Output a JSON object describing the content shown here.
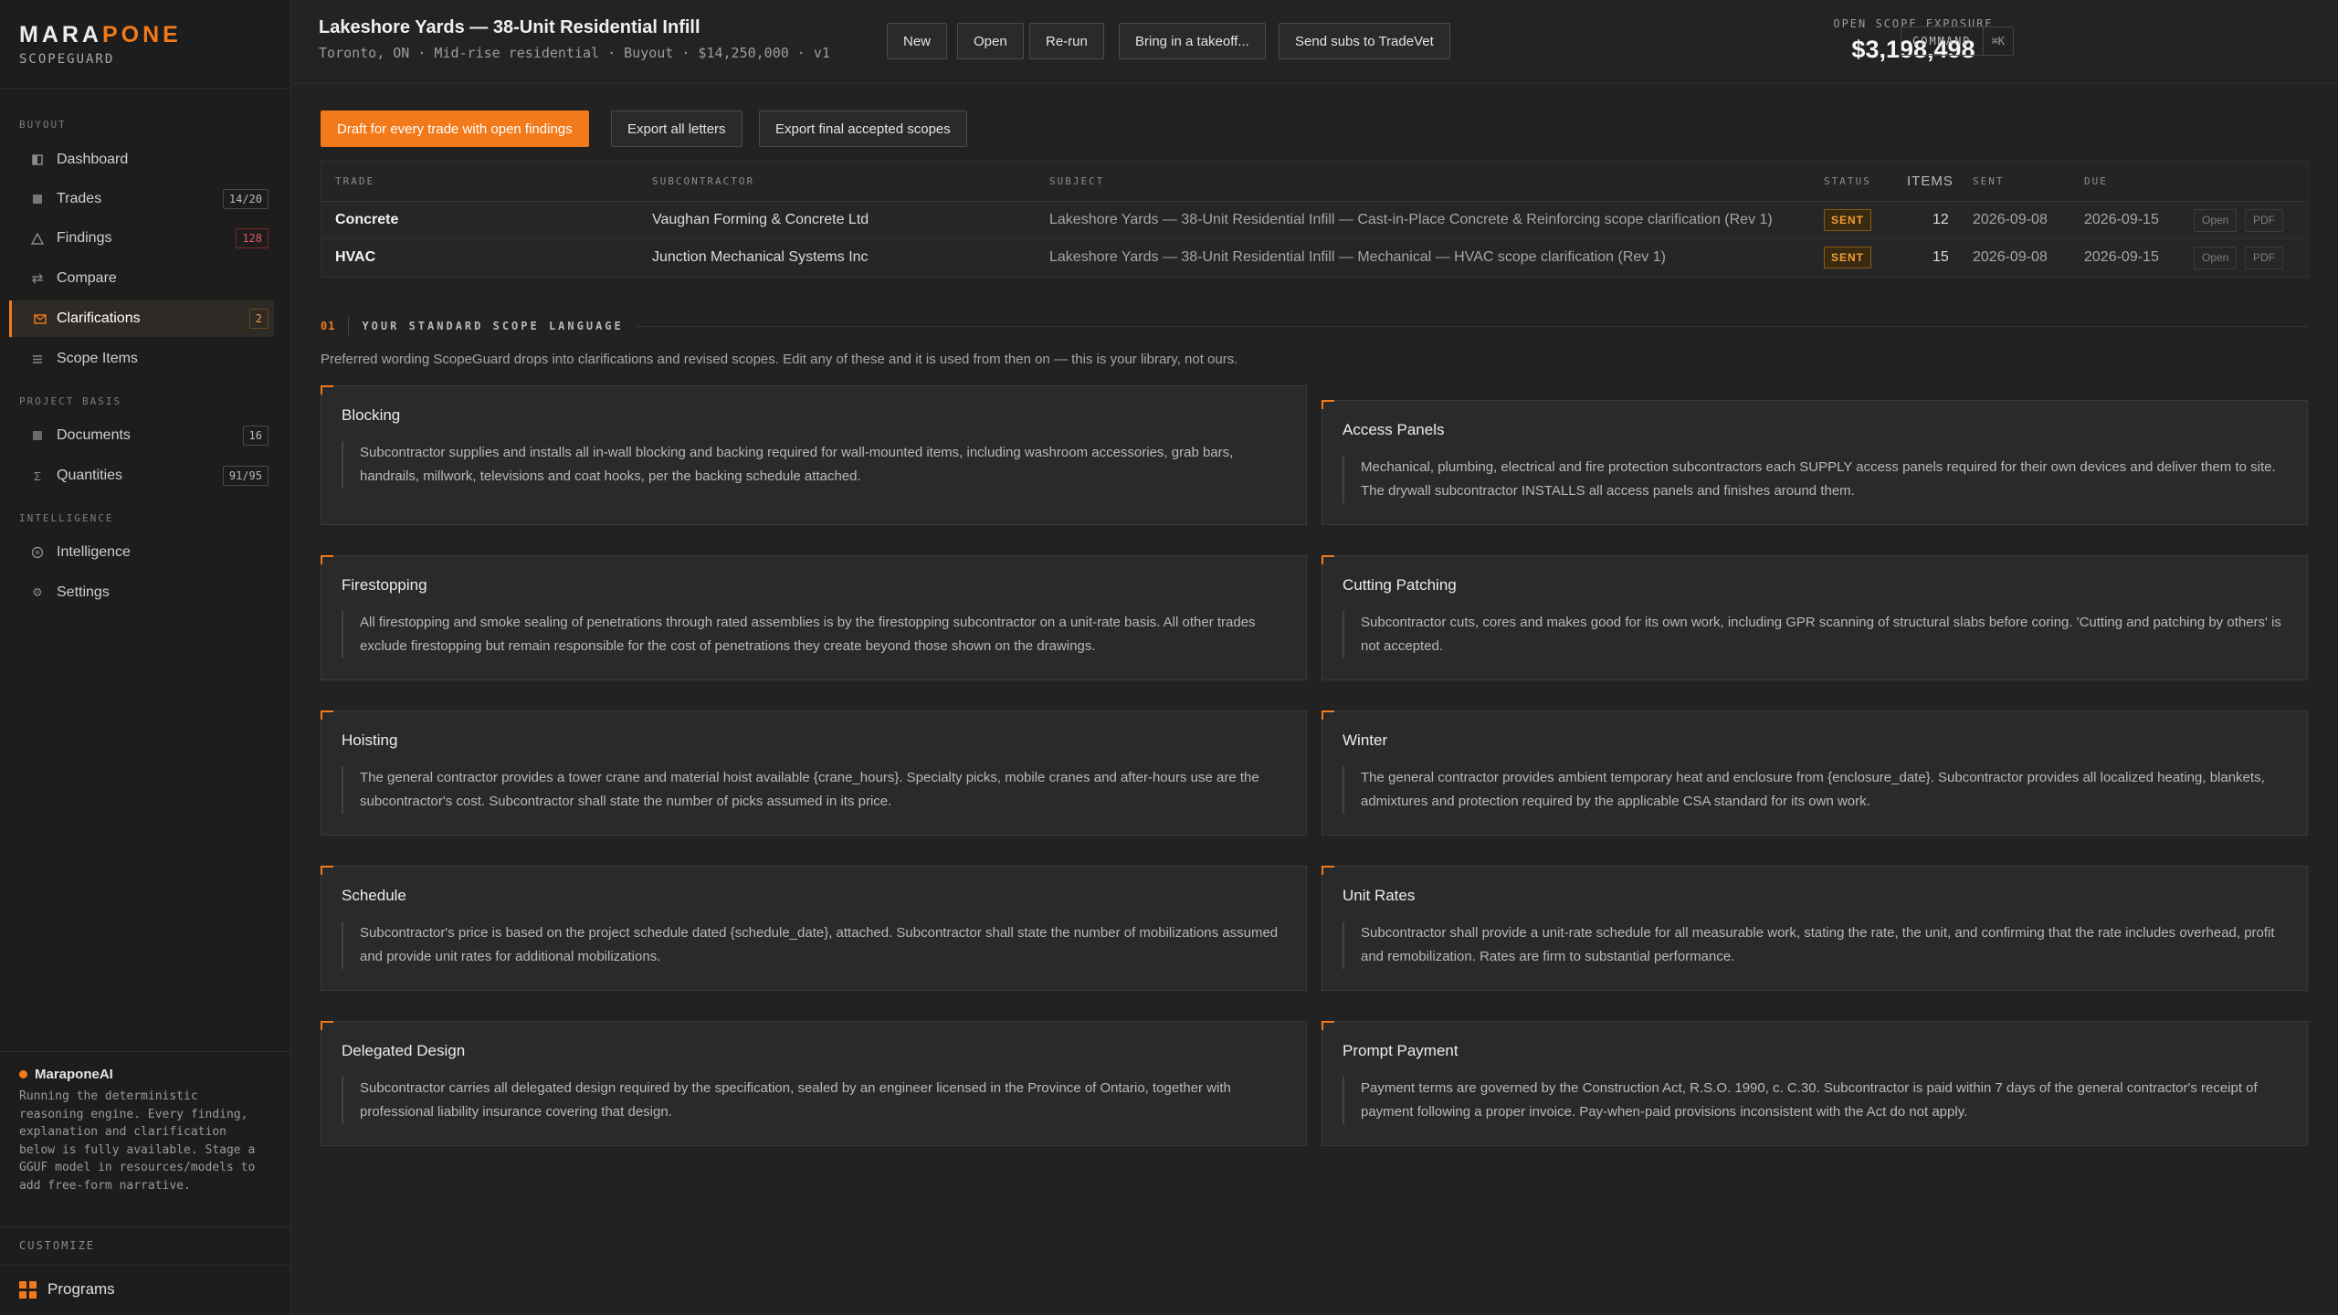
{
  "brand": {
    "name_a": "MARA",
    "name_b": "PONE",
    "product": "SCOPEGUARD"
  },
  "sidebar": {
    "sections": [
      {
        "label": "BUYOUT"
      },
      {
        "label": "PROJECT BASIS"
      },
      {
        "label": "INTELLIGENCE"
      }
    ],
    "items": [
      {
        "label": "Dashboard",
        "icon": "dashboard-icon",
        "badge": ""
      },
      {
        "label": "Trades",
        "icon": "trades-icon",
        "badge": "14/20"
      },
      {
        "label": "Findings",
        "icon": "warning-icon",
        "badge": "128"
      },
      {
        "label": "Compare",
        "icon": "compare-icon",
        "badge": ""
      },
      {
        "label": "Clarifications",
        "icon": "mail-icon",
        "badge": "2"
      },
      {
        "label": "Scope Items",
        "icon": "list-icon",
        "badge": ""
      },
      {
        "label": "Documents",
        "icon": "documents-icon",
        "badge": "16"
      },
      {
        "label": "Quantities",
        "icon": "sigma-icon",
        "badge": "91/95"
      },
      {
        "label": "Intelligence",
        "icon": "intelligence-icon",
        "badge": ""
      },
      {
        "label": "Settings",
        "icon": "gear-icon",
        "badge": ""
      }
    ],
    "ai": {
      "title": "MaraponeAI",
      "description": "Running the deterministic reasoning engine. Every finding, explanation and clarification below is fully available. Stage a GGUF model in resources/models to add free-form narrative."
    },
    "customize_label": "CUSTOMIZE",
    "programs_label": "Programs"
  },
  "header": {
    "title": "Lakeshore Yards — 38-Unit Residential Infill",
    "subtitle": "Toronto, ON · Mid-rise residential · Buyout · $14,250,000 · v1",
    "buttons": [
      "New",
      "Open",
      "Re-run",
      "Bring in a takeoff...",
      "Send subs to TradeVet"
    ],
    "exposure_label": "OPEN SCOPE EXPOSURE",
    "exposure_value": "$3,198,498",
    "command_label": "COMMAND",
    "command_shortcut": "⌘K"
  },
  "actions": {
    "draft": "Draft for every trade with open findings",
    "export_letters": "Export all letters",
    "export_scopes": "Export final accepted scopes"
  },
  "table": {
    "headers": {
      "trade": "TRADE",
      "subcontractor": "SUBCONTRACTOR",
      "subject": "SUBJECT",
      "status": "STATUS",
      "items": "ITEMS",
      "sent": "SENT",
      "due": "DUE"
    },
    "rows": [
      {
        "trade": "Concrete",
        "subcontractor": "Vaughan Forming & Concrete Ltd",
        "subject": "Lakeshore Yards — 38-Unit Residential Infill — Cast-in-Place Concrete & Reinforcing scope clarification (Rev 1)",
        "status": "SENT",
        "items": "12",
        "sent": "2026-09-08",
        "due": "2026-09-15",
        "open": "Open",
        "pdf": "PDF"
      },
      {
        "trade": "HVAC",
        "subcontractor": "Junction Mechanical Systems Inc",
        "subject": "Lakeshore Yards — 38-Unit Residential Infill — Mechanical — HVAC scope clarification (Rev 1)",
        "status": "SENT",
        "items": "15",
        "sent": "2026-09-08",
        "due": "2026-09-15",
        "open": "Open",
        "pdf": "PDF"
      }
    ]
  },
  "scope_section": {
    "number": "01",
    "title": "YOUR STANDARD SCOPE LANGUAGE",
    "description": "Preferred wording ScopeGuard drops into clarifications and revised scopes. Edit any of these and it is used from then on — this is your library, not ours.",
    "cards": [
      {
        "title": "Blocking",
        "body": "Subcontractor supplies and installs all in-wall blocking and backing required for wall-mounted items, including washroom accessories, grab bars, handrails, millwork, televisions and coat hooks, per the backing schedule attached."
      },
      {
        "title": "Access Panels",
        "body": "Mechanical, plumbing, electrical and fire protection subcontractors each SUPPLY access panels required for their own devices and deliver them to site. The drywall subcontractor INSTALLS all access panels and finishes around them."
      },
      {
        "title": "Firestopping",
        "body": "All firestopping and smoke sealing of penetrations through rated assemblies is by the firestopping subcontractor on a unit-rate basis. All other trades exclude firestopping but remain responsible for the cost of penetrations they create beyond those shown on the drawings."
      },
      {
        "title": "Cutting Patching",
        "body": "Subcontractor cuts, cores and makes good for its own work, including GPR scanning of structural slabs before coring. 'Cutting and patching by others' is not accepted."
      },
      {
        "title": "Hoisting",
        "body": "The general contractor provides a tower crane and material hoist available {crane_hours}. Specialty picks, mobile cranes and after-hours use are the subcontractor's cost. Subcontractor shall state the number of picks assumed in its price."
      },
      {
        "title": "Winter",
        "body": "The general contractor provides ambient temporary heat and enclosure from {enclosure_date}. Subcontractor provides all localized heating, blankets, admixtures and protection required by the applicable CSA standard for its own work."
      },
      {
        "title": "Schedule",
        "body": "Subcontractor's price is based on the project schedule dated {schedule_date}, attached. Subcontractor shall state the number of mobilizations assumed and provide unit rates for additional mobilizations."
      },
      {
        "title": "Unit Rates",
        "body": "Subcontractor shall provide a unit-rate schedule for all measurable work, stating the rate, the unit, and confirming that the rate includes overhead, profit and remobilization. Rates are firm to substantial performance."
      },
      {
        "title": "Delegated Design",
        "body": "Subcontractor carries all delegated design required by the specification, sealed by an engineer licensed in the Province of Ontario, together with professional liability insurance covering that design."
      },
      {
        "title": "Prompt Payment",
        "body": "Payment terms are governed by the Construction Act, R.S.O. 1990, c. C.30. Subcontractor is paid within 7 days of the general contractor's receipt of payment following a proper invoice. Pay-when-paid provisions inconsistent with the Act do not apply."
      }
    ]
  },
  "colors": {
    "accent": "#f27a1a",
    "background": "#222222",
    "sidebar": "#1d1d1d",
    "status_sent": "#f0a033"
  }
}
